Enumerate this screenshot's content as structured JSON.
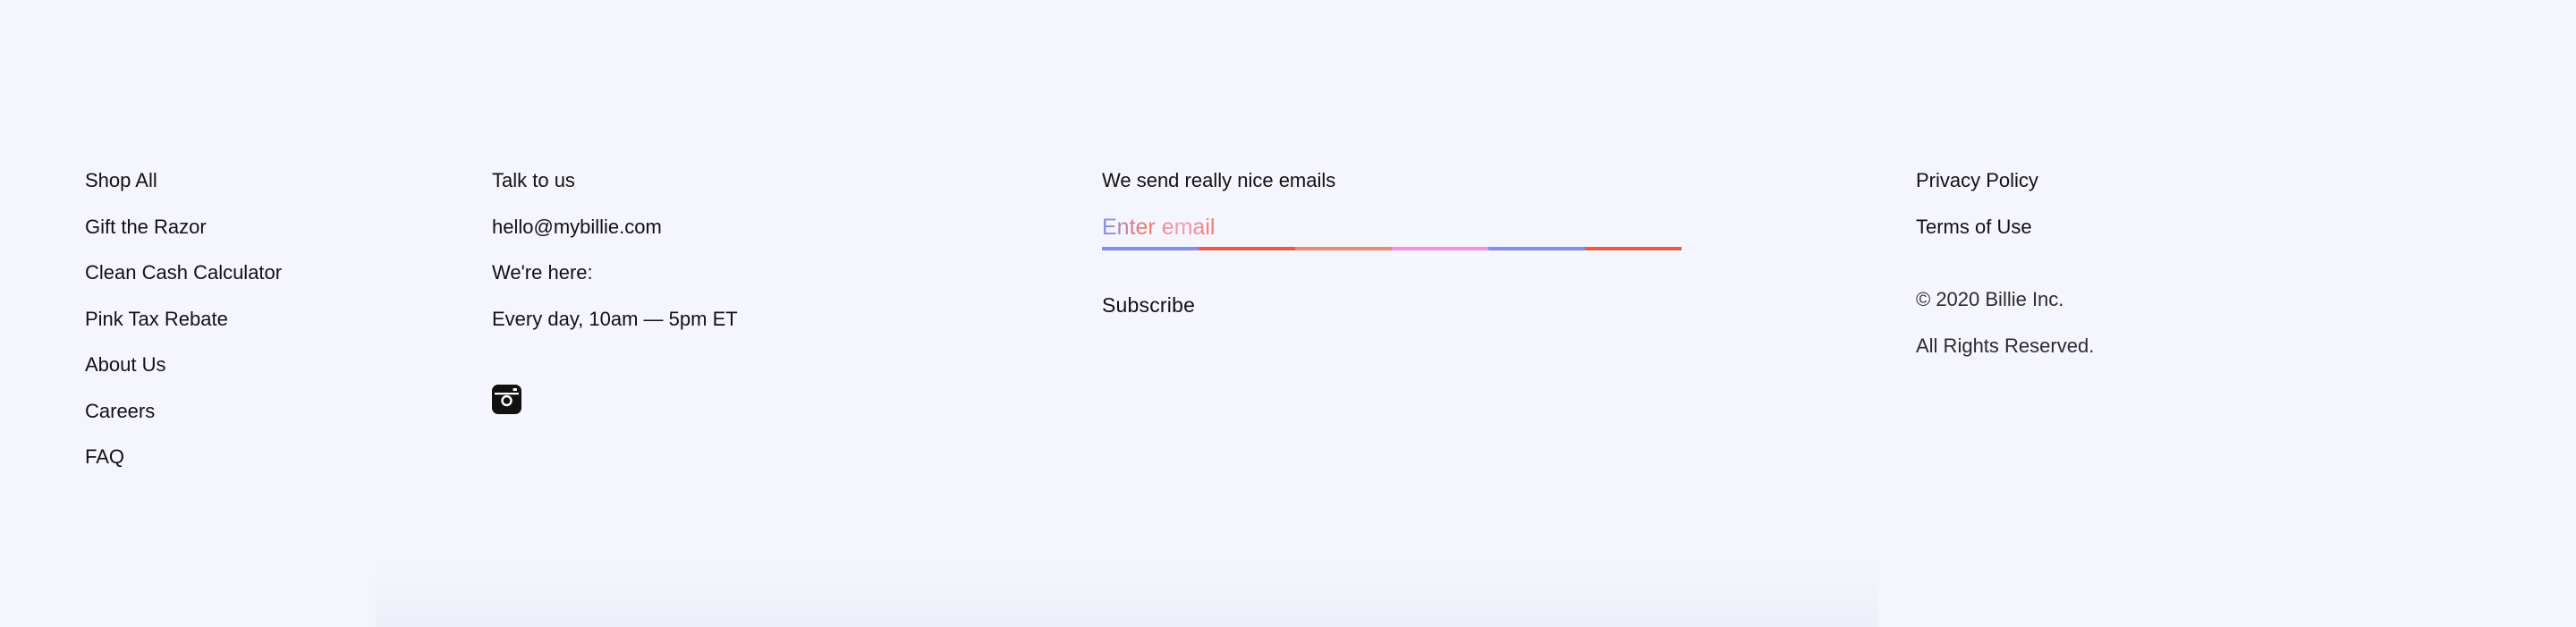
{
  "nav": {
    "items": [
      {
        "label": "Shop All"
      },
      {
        "label": "Gift the Razor"
      },
      {
        "label": "Clean Cash Calculator"
      },
      {
        "label": "Pink Tax Rebate"
      },
      {
        "label": "About Us"
      },
      {
        "label": "Careers"
      },
      {
        "label": "FAQ"
      }
    ]
  },
  "contact": {
    "heading": "Talk to us",
    "email": "hello@mybillie.com",
    "hours_label": "We're here:",
    "hours": "Every day, 10am — 5pm ET",
    "social_icon": "instagram-icon"
  },
  "newsletter": {
    "heading": "We send really nice emails",
    "placeholder": "Enter email",
    "input_value": "",
    "underline_colors": [
      "#7f8ff0",
      "#f05a3c",
      "#f08a6a",
      "#f58fe0",
      "#7f8ff0",
      "#f05a3c"
    ],
    "subscribe_label": "Subscribe"
  },
  "legal": {
    "links": [
      {
        "label": "Privacy Policy"
      },
      {
        "label": "Terms of Use"
      }
    ],
    "copyright": "© 2020 Billie Inc.",
    "rights": "All Rights Reserved."
  },
  "colors": {
    "background": "#f5f5fd",
    "text": "#111111"
  }
}
